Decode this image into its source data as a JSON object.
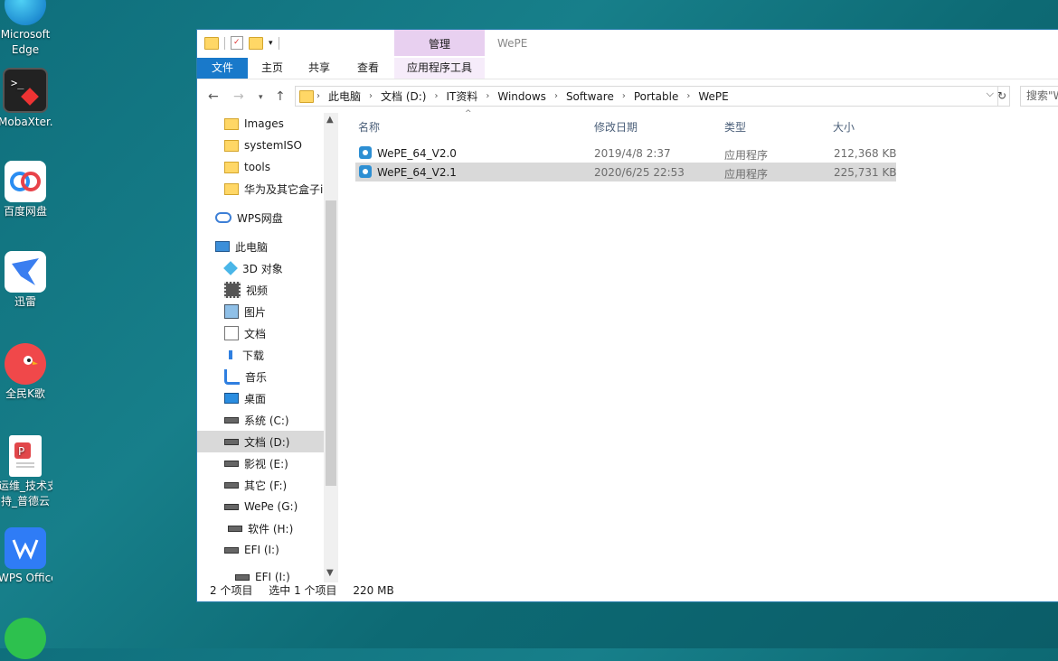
{
  "desktop": {
    "icons": [
      {
        "label_line1": "Microsoft",
        "label_line2": "Edge",
        "icon": "edge-icon"
      },
      {
        "label_line1": "MobaXter...",
        "label_line2": "",
        "icon": "mobaxterm-icon"
      },
      {
        "label_line1": "百度网盘",
        "label_line2": "",
        "icon": "baidu-netdisk-icon"
      },
      {
        "label_line1": "迅雷",
        "label_line2": "",
        "icon": "xunlei-icon"
      },
      {
        "label_line1": "全民K歌",
        "label_line2": "",
        "icon": "quanmin-kge-icon"
      },
      {
        "label_line1": "运维_技术支",
        "label_line2": "持_普德云",
        "icon": "wps-doc-icon"
      },
      {
        "label_line1": "WPS Office",
        "label_line2": "",
        "icon": "wps-office-icon"
      }
    ]
  },
  "window": {
    "title": "WePE",
    "contextual_tab_top": "管理",
    "ribbon_tabs": [
      "文件",
      "主页",
      "共享",
      "查看",
      "应用程序工具"
    ],
    "address": {
      "crumbs": [
        "此电脑",
        "文档 (D:)",
        "IT资料",
        "Windows",
        "Software",
        "Portable",
        "WePE"
      ]
    },
    "search_placeholder": "搜索\"WePE\""
  },
  "nav_pane": {
    "items": [
      {
        "label": "Images",
        "icon": "folder-icon",
        "top": 0
      },
      {
        "label": "systemISO",
        "icon": "folder-icon"
      },
      {
        "label": "tools",
        "icon": "folder-icon"
      },
      {
        "label": "华为及其它盒子i",
        "icon": "folder-icon"
      },
      {
        "label": "WPS网盘",
        "icon": "cloud-icon"
      },
      {
        "label": "此电脑",
        "icon": "computer-icon"
      },
      {
        "label": "3D 对象",
        "icon": "cube-icon"
      },
      {
        "label": "视频",
        "icon": "video-icon"
      },
      {
        "label": "图片",
        "icon": "picture-icon"
      },
      {
        "label": "文档",
        "icon": "document-icon"
      },
      {
        "label": "下载",
        "icon": "download-icon"
      },
      {
        "label": "音乐",
        "icon": "music-icon"
      },
      {
        "label": "桌面",
        "icon": "desktop-icon"
      },
      {
        "label": "系统 (C:)",
        "icon": "drive-icon"
      },
      {
        "label": "文档 (D:)",
        "icon": "drive-icon",
        "selected": true
      },
      {
        "label": "影视 (E:)",
        "icon": "drive-icon"
      },
      {
        "label": "其它 (F:)",
        "icon": "drive-icon"
      },
      {
        "label": "WePe (G:)",
        "icon": "drive-icon"
      },
      {
        "label": "软件 (H:)",
        "icon": "drive-icon"
      },
      {
        "label": "EFI (I:)",
        "icon": "drive-icon"
      },
      {
        "label": "EFI (I:)",
        "icon": "drive-icon"
      }
    ]
  },
  "list": {
    "columns": [
      "名称",
      "修改日期",
      "类型",
      "大小"
    ],
    "rows": [
      {
        "name": "WePE_64_V2.0",
        "date": "2019/4/8 2:37",
        "type": "应用程序",
        "size": "212,368 KB",
        "selected": false
      },
      {
        "name": "WePE_64_V2.1",
        "date": "2020/6/25 22:53",
        "type": "应用程序",
        "size": "225,731 KB",
        "selected": true
      }
    ]
  },
  "status": {
    "count": "2 个项目",
    "selection": "选中 1 个项目",
    "size": "220 MB"
  }
}
